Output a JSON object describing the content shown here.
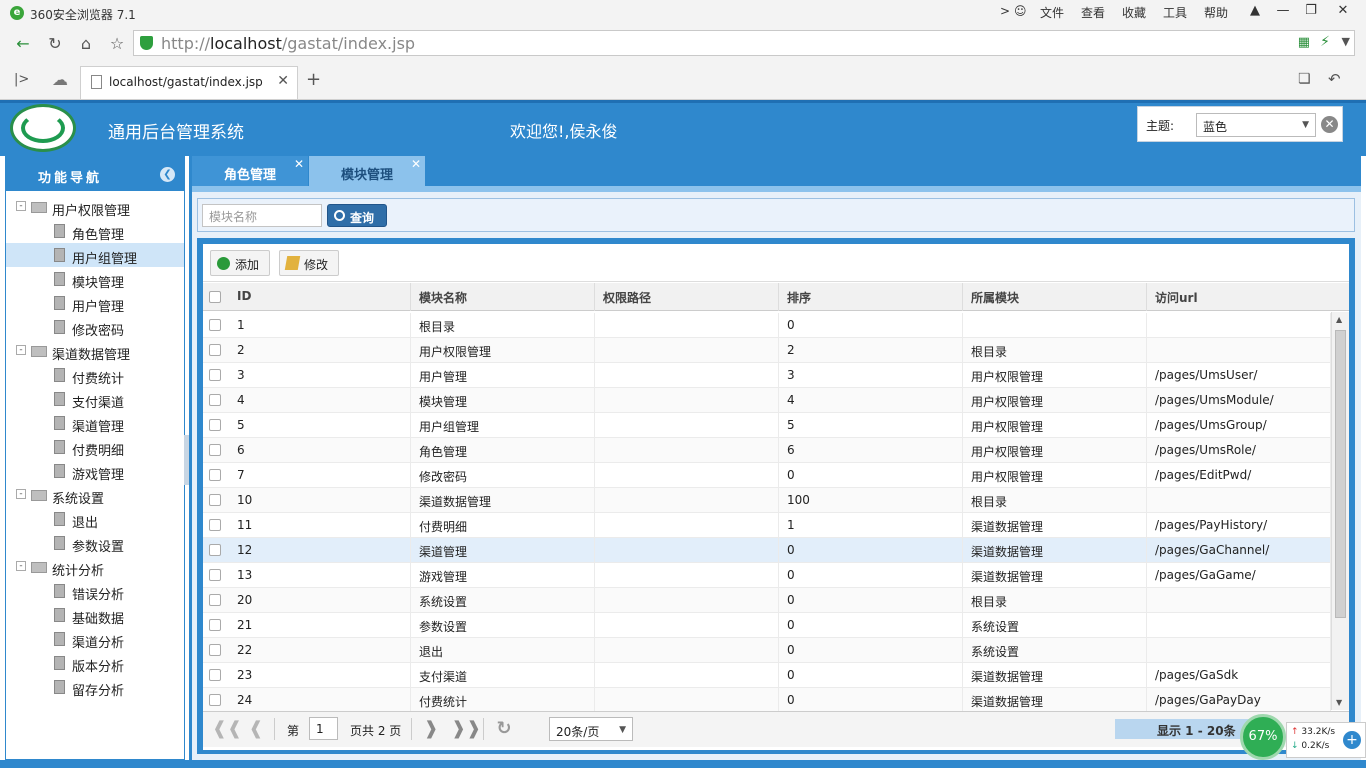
{
  "browser": {
    "app_title": "360安全浏览器 7.1",
    "menu": [
      "文件",
      "查看",
      "收藏",
      "工具",
      "帮助"
    ],
    "url_prefix": "http://",
    "url_host": "localhost",
    "url_path": "/gastat/index.jsp",
    "tab_title": "localhost/gastat/index.jsp"
  },
  "header": {
    "system_title": "通用后台管理系统",
    "welcome": "欢迎您!,侯永俊",
    "theme_label": "主题:",
    "theme_value": "蓝色"
  },
  "sidebar": {
    "title": "功能导航",
    "groups": [
      {
        "label": "用户权限管理",
        "items": [
          "角色管理",
          "用户组管理",
          "模块管理",
          "用户管理",
          "修改密码"
        ]
      },
      {
        "label": "渠道数据管理",
        "items": [
          "付费统计",
          "支付渠道",
          "渠道管理",
          "付费明细",
          "游戏管理"
        ]
      },
      {
        "label": "系统设置",
        "items": [
          "退出",
          "参数设置"
        ]
      },
      {
        "label": "统计分析",
        "items": [
          "错误分析",
          "基础数据",
          "渠道分析",
          "版本分析",
          "留存分析"
        ]
      }
    ],
    "selected": "用户组管理"
  },
  "tabs": [
    {
      "label": "角色管理"
    },
    {
      "label": "模块管理"
    }
  ],
  "search": {
    "placeholder": "模块名称",
    "button": "查询"
  },
  "toolbar": {
    "add": "添加",
    "edit": "修改"
  },
  "table": {
    "columns": [
      "ID",
      "模块名称",
      "权限路径",
      "排序",
      "所属模块",
      "访问url"
    ],
    "rows": [
      [
        "1",
        "根目录",
        "",
        "0",
        "",
        ""
      ],
      [
        "2",
        "用户权限管理",
        "",
        "2",
        "根目录",
        ""
      ],
      [
        "3",
        "用户管理",
        "",
        "3",
        "用户权限管理",
        "/pages/UmsUser/"
      ],
      [
        "4",
        "模块管理",
        "",
        "4",
        "用户权限管理",
        "/pages/UmsModule/"
      ],
      [
        "5",
        "用户组管理",
        "",
        "5",
        "用户权限管理",
        "/pages/UmsGroup/"
      ],
      [
        "6",
        "角色管理",
        "",
        "6",
        "用户权限管理",
        "/pages/UmsRole/"
      ],
      [
        "7",
        "修改密码",
        "",
        "0",
        "用户权限管理",
        "/pages/EditPwd/"
      ],
      [
        "10",
        "渠道数据管理",
        "",
        "100",
        "根目录",
        ""
      ],
      [
        "11",
        "付费明细",
        "",
        "1",
        "渠道数据管理",
        "/pages/PayHistory/"
      ],
      [
        "12",
        "渠道管理",
        "",
        "0",
        "渠道数据管理",
        "/pages/GaChannel/"
      ],
      [
        "13",
        "游戏管理",
        "",
        "0",
        "渠道数据管理",
        "/pages/GaGame/"
      ],
      [
        "20",
        "系统设置",
        "",
        "0",
        "根目录",
        ""
      ],
      [
        "21",
        "参数设置",
        "",
        "0",
        "系统设置",
        ""
      ],
      [
        "22",
        "退出",
        "",
        "0",
        "系统设置",
        ""
      ],
      [
        "23",
        "支付渠道",
        "",
        "0",
        "渠道数据管理",
        "/pages/GaSdk"
      ],
      [
        "24",
        "付费统计",
        "",
        "0",
        "渠道数据管理",
        "/pages/GaPayDay"
      ]
    ],
    "highlighted_row_id": "12"
  },
  "pager": {
    "page_prefix": "第",
    "page_value": "1",
    "page_suffix": "页共 2 页",
    "page_size": "20条/页",
    "display_info": "显示 1 - 20条"
  },
  "widget": {
    "percent": "67%",
    "up_speed": "33.2K/s",
    "down_speed": "0.2K/s"
  },
  "colors": {
    "primary": "#2f88cd",
    "highlight": "#e2eefa"
  }
}
